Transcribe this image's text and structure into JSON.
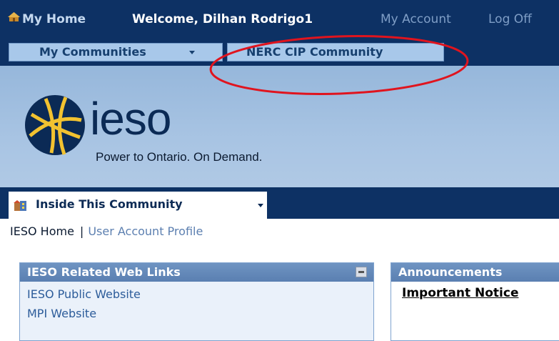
{
  "header": {
    "my_home": "My Home",
    "welcome": "Welcome, Dilhan Rodrigo1",
    "my_account": "My Account",
    "log_off": "Log Off"
  },
  "community_tabs": {
    "my_communities": "My Communities",
    "nerc_cip": "NERC CIP Community"
  },
  "banner": {
    "logo_text": "ieso",
    "tagline": "Power to Ontario. On Demand."
  },
  "inside_community": {
    "label": "Inside This Community"
  },
  "subnav": {
    "ieso_home": "IESO Home",
    "separator": "|",
    "user_profile": "User Account Profile"
  },
  "panels": {
    "web_links": {
      "title": "IESO Related Web Links",
      "links": [
        "IESO Public Website",
        "MPI Website"
      ]
    },
    "announcements": {
      "title": "Announcements",
      "first_item": "Important Notice"
    }
  },
  "colors": {
    "nav_dark": "#0d3164",
    "tab_light": "#a8c8ea",
    "banner": "#a8c4e3",
    "panel_header": "#5a7fb1",
    "annotation": "#e0141e"
  },
  "icons": [
    "home-icon",
    "building-icon",
    "ieso-star-logo",
    "minimize-icon"
  ]
}
